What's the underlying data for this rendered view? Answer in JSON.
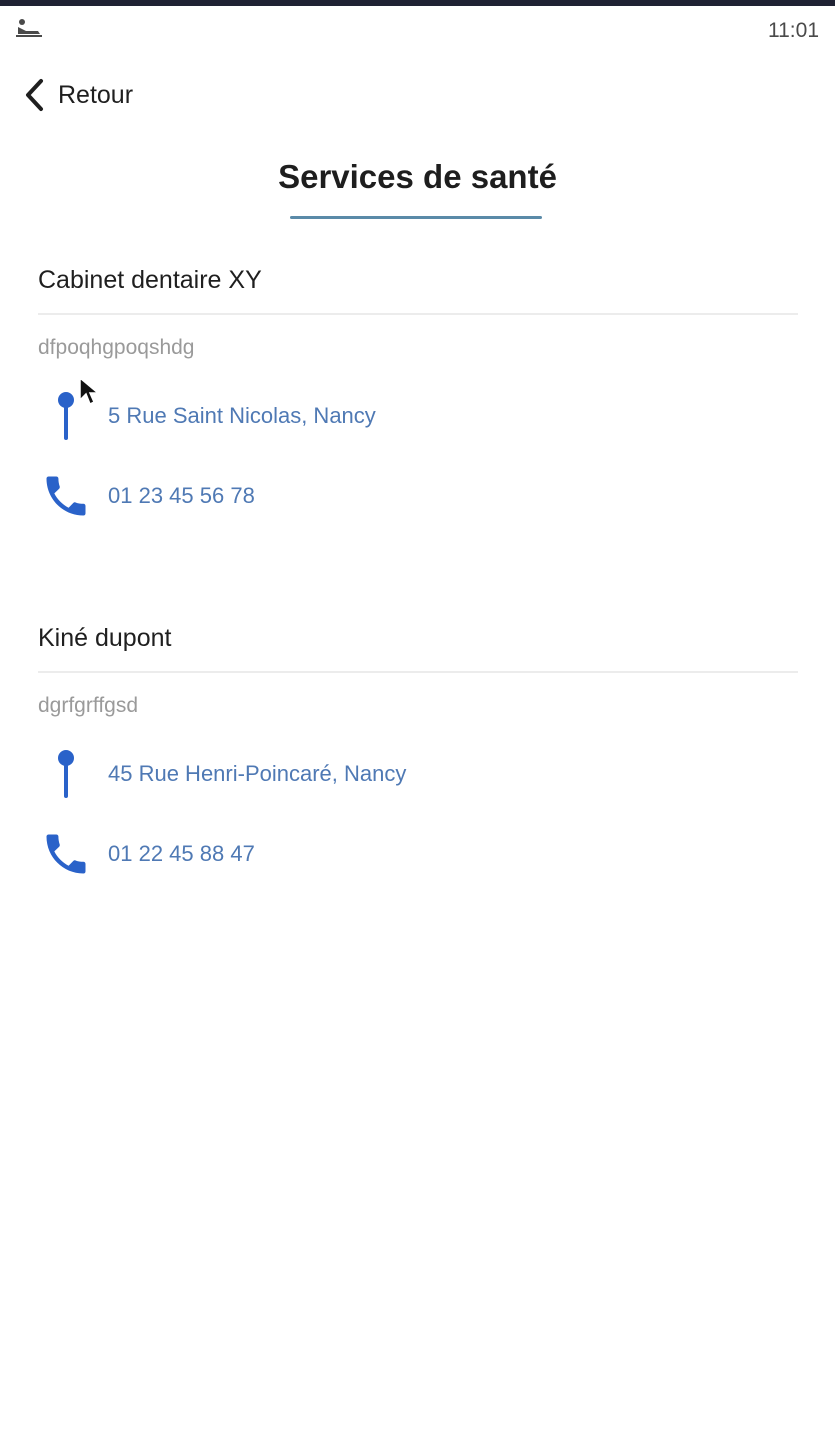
{
  "status_bar": {
    "time": "11:01",
    "notification_icon": "app-notification-icon"
  },
  "header": {
    "back_label": "Retour",
    "back_icon": "chevron-left-icon",
    "title": "Services de santé"
  },
  "services": [
    {
      "name": "Cabinet dentaire XY",
      "description": "dfpoqhgpoqshdg",
      "address": "5 Rue Saint Nicolas, Nancy",
      "phone": "01 23 45 56 78"
    },
    {
      "name": "Kiné dupont",
      "description": "dgrfgrffgsd",
      "address": "45 Rue Henri-Poincaré, Nancy",
      "phone": "01 22 45 88 47"
    }
  ],
  "icons": {
    "address": "map-pin-icon",
    "phone": "phone-icon"
  },
  "colors": {
    "accent": "#4f79b4",
    "icon_blue": "#2a62c9",
    "title_underline": "#5a8aa8"
  }
}
